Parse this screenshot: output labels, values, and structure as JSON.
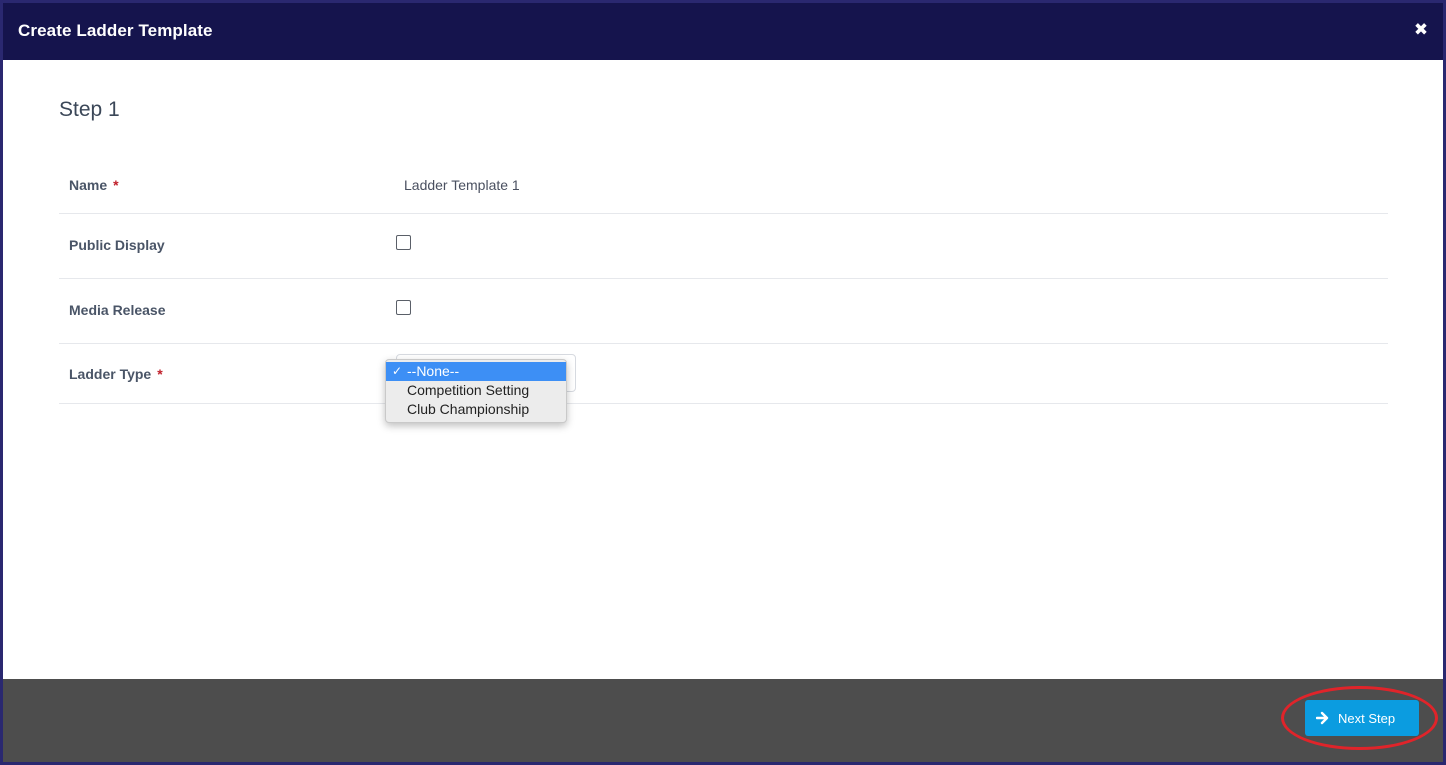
{
  "modal": {
    "title": "Create Ladder Template",
    "close_icon": "times-icon"
  },
  "step": {
    "title": "Step 1"
  },
  "form": {
    "name": {
      "label": "Name",
      "required_mark": "*",
      "value": "Ladder Template 1"
    },
    "public_display": {
      "label": "Public Display",
      "checked": false
    },
    "media_release": {
      "label": "Media Release",
      "checked": false
    },
    "ladder_type": {
      "label": "Ladder Type",
      "required_mark": "*",
      "selected": "--None--",
      "options": [
        {
          "label": "--None--",
          "selected": true,
          "check": "✓"
        },
        {
          "label": "Competition Setting",
          "selected": false,
          "check": ""
        },
        {
          "label": "Club Championship",
          "selected": false,
          "check": ""
        }
      ]
    }
  },
  "footer": {
    "next_label": "Next Step",
    "next_icon": "arrow-right-icon"
  },
  "colors": {
    "header_bg": "#15144d",
    "footer_bg": "#4d4d4d",
    "button_bg": "#0b9ce0",
    "required": "#c0202b",
    "annotation": "#e0242a",
    "dropdown_highlight": "#3d8ff5"
  }
}
